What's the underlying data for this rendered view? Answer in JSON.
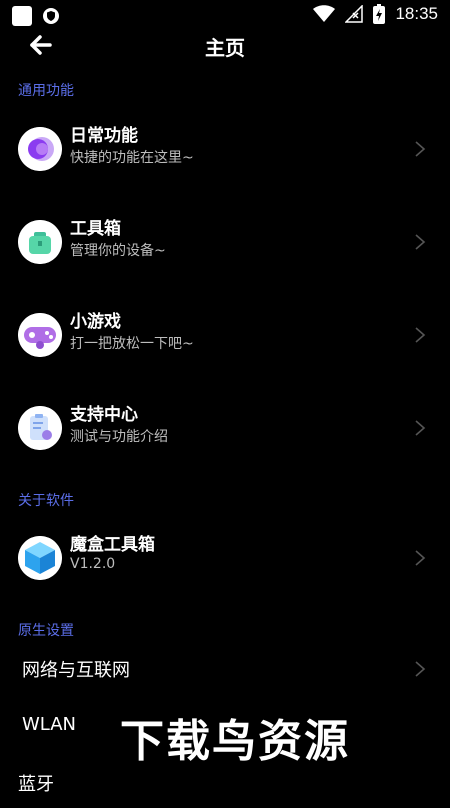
{
  "status_bar": {
    "time": "18:35"
  },
  "header": {
    "title": "主页"
  },
  "sections": {
    "general": "通用功能",
    "about": "关于软件",
    "native": "原生设置"
  },
  "general_items": [
    {
      "title": "日常功能",
      "subtitle": "快捷的功能在这里~"
    },
    {
      "title": "工具箱",
      "subtitle": "管理你的设备~"
    },
    {
      "title": "小游戏",
      "subtitle": "打一把放松一下吧~"
    },
    {
      "title": "支持中心",
      "subtitle": "测试与功能介绍"
    }
  ],
  "about_item": {
    "title": "魔盒工具箱",
    "subtitle": "V1.2.0"
  },
  "native_items": [
    {
      "label": "网络与互联网"
    },
    {
      "label": "WLAN"
    },
    {
      "label": "蓝牙"
    }
  ],
  "watermark": "下载鸟资源",
  "colors": {
    "accent": "#5b6ee8",
    "background": "#000000"
  }
}
